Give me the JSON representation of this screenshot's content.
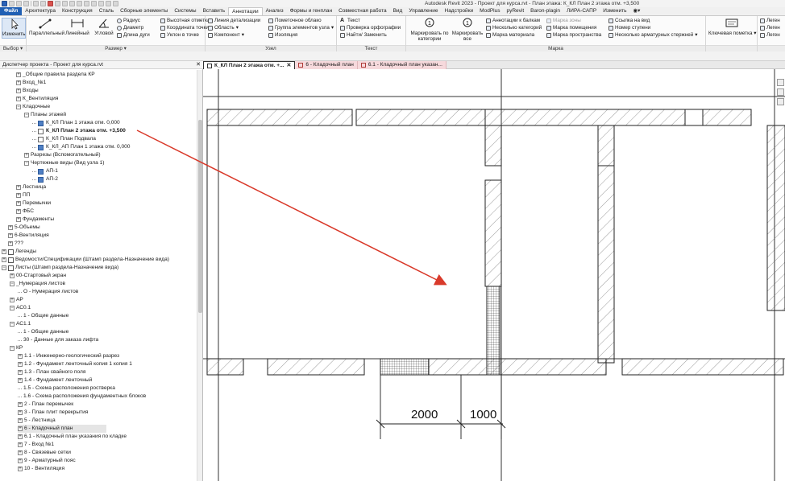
{
  "window": {
    "title": "Autodesk Revit 2023 - Проект для курса.rvt - План этажа: К_КЛ План 2 этажа отм. +3,500"
  },
  "ribbon_tabs": [
    "Файл",
    "Архитектура",
    "Конструкция",
    "Сталь",
    "Сборные элементы",
    "Системы",
    "Вставить",
    "Аннотации",
    "Анализ",
    "Формы и генплан",
    "Совместная работа",
    "Вид",
    "Управление",
    "Надстройки",
    "ModPlus",
    "pyRevit",
    "Baron-plagin",
    "ЛИРА-САПР",
    "Изменить"
  ],
  "ribbon": {
    "select": {
      "modify": "Изменить",
      "label": "Выбор ▾"
    },
    "dimension": {
      "parallel": "Параллельный",
      "linear": "Линейный",
      "angular": "Угловой",
      "radius": "Радиус",
      "diameter": "Диаметр",
      "arc_length": "Длина дуги",
      "spot_elevation": "Высотная отметка",
      "spot_coordinate": "Координата точки",
      "spot_slope": "Уклон в точке",
      "label": "Размер ▾"
    },
    "detail": {
      "detail_line": "Линия детализации",
      "region": "Область",
      "component": "Компонент",
      "revision_cloud": "Пометочное облако",
      "detail_group": "Группа элементов узла",
      "insulation": "Изоляция",
      "label": "Узел"
    },
    "text": {
      "text": "Текст",
      "spelling": "Проверка орфографии",
      "find_replace": "Найти/ Заменить",
      "label": "Текст"
    },
    "tag": {
      "tag_by_category": "Маркировать по категории",
      "tag_all": "Маркировать все",
      "beam_annotations": "Аннотации к балкам",
      "multi_category": "Несколько категорий",
      "material_tag": "Марка материала",
      "area_tag": "Марка зоны",
      "room_tag": "Марка помещения",
      "space_tag": "Марка пространства",
      "view_reference": "Ссылка на вид",
      "tread_number": "Номер ступени",
      "multi_rebar": "Несколько арматурных стержней",
      "label": "Марка"
    },
    "keynote": "Ключевая пометка",
    "legend_1": "Леген",
    "legend_2": "Леген",
    "legend_3": "Леген"
  },
  "project_browser": {
    "title": "Диспетчер проекта - Проект для курса.rvt",
    "close": "✕",
    "items": [
      "_Общие правила раздела КР",
      "Вход_№1",
      "Входы",
      "К_Вентиляция",
      "Кладочные",
      "Планы этажей",
      "К_КЛ План 1 этажа отм. 0,000",
      "К_КЛ План 2 этажа отм. +3,500",
      "К_КЛ План Подвала",
      "К_КЛ_АП План 1 этажа отм. 0,000",
      "Разрезы (Вспомогательный)",
      "Чертежные виды (Вид узла 1)",
      "АП-1",
      "АП-2",
      "Лестница",
      "ПП",
      "Перемычки",
      "ФБС",
      "Фундаменты",
      "5-Объемы",
      "6-Вентиляция",
      "???",
      "Легенды",
      "Ведомости/Спецификации (Штамп раздела-Назначение вида)",
      "Листы (Штамп раздела-Назначение вида)",
      "00-Стартовый экран",
      "_Нумерация листов",
      "О - Нумерация листов",
      "АР",
      "АС0.1",
      "1 - Общие данные",
      "АС1.1",
      "1 - Общие данные",
      "30 - Данные для заказа лифта",
      "КР",
      "1.1 - Инженерно-геологический разрез",
      "1.2 - Фундамент ленточный копия 1 копия 1",
      "1.3 - План свайного поля",
      "1.4 - Фундамент ленточный",
      "1.5 - Схема расположения ростверка",
      "1.6 - Схема расположения фундаментных блоков",
      "2 - План перемычек",
      "3 - План плит перекрытия",
      "5 - Лестница",
      "6 - Кладочный план",
      "6.1 - Кладочный план указания по кладке",
      "7 - Вход №1",
      "8 - Связевые сетки",
      "9 - Арматурный пояс",
      "10 - Вентиляция"
    ]
  },
  "doc_tabs": [
    {
      "label": "К_КЛ План 2 этажа отм. +...",
      "close": "✕"
    },
    {
      "label": "6 - Кладочный план",
      "close": ""
    },
    {
      "label": "6.1 - Кладочный план указан...",
      "close": ""
    }
  ],
  "drawing": {
    "dimensions": [
      "2000",
      "1000"
    ],
    "annotation_arrow_color": "#d93a2b"
  },
  "colors": {
    "file_tab": "#1f5fb4",
    "view_icon": "#4f7fc4",
    "doc_tab_pink": "#f6d9dc"
  }
}
